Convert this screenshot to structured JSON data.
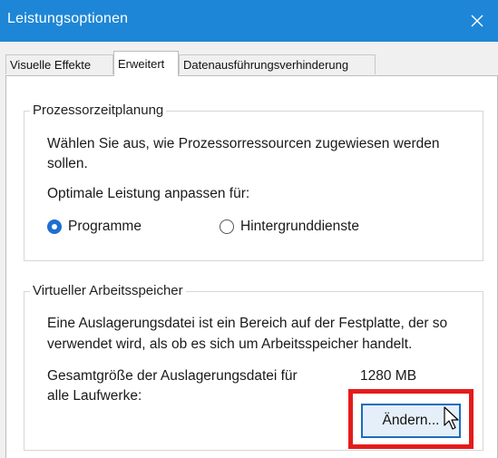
{
  "window": {
    "title": "Leistungsoptionen"
  },
  "tabs": [
    {
      "label": "Visuelle Effekte",
      "active": false
    },
    {
      "label": "Erweitert",
      "active": true
    },
    {
      "label": "Datenausführungsverhinderung",
      "active": false
    }
  ],
  "processor": {
    "group_title": "Prozessorzeitplanung",
    "description_line1": "Wählen Sie aus, wie Prozessorressourcen zugewiesen werden",
    "description_line2": "sollen.",
    "optimize_label": "Optimale Leistung anpassen für:",
    "options": [
      {
        "label": "Programme",
        "selected": true
      },
      {
        "label": "Hintergrunddienste",
        "selected": false
      }
    ]
  },
  "virtual_memory": {
    "group_title": "Virtueller Arbeitsspeicher",
    "description_line1": "Eine Auslagerungsdatei ist ein Bereich auf der Festplatte, der so",
    "description_line2": "verwendet wird, als ob es sich um Arbeitsspeicher handelt.",
    "total_label_line1": "Gesamtgröße der Auslagerungsdatei für",
    "total_label_line2": "alle Laufwerke:",
    "total_value": "1280 MB",
    "change_button": "Ändern..."
  },
  "colors": {
    "titlebar": "#1e86d6",
    "highlight_frame": "#e51b1b",
    "radio_selected": "#1e6fd1"
  },
  "icons": {
    "close": "close-icon",
    "cursor": "mouse-pointer-icon"
  }
}
